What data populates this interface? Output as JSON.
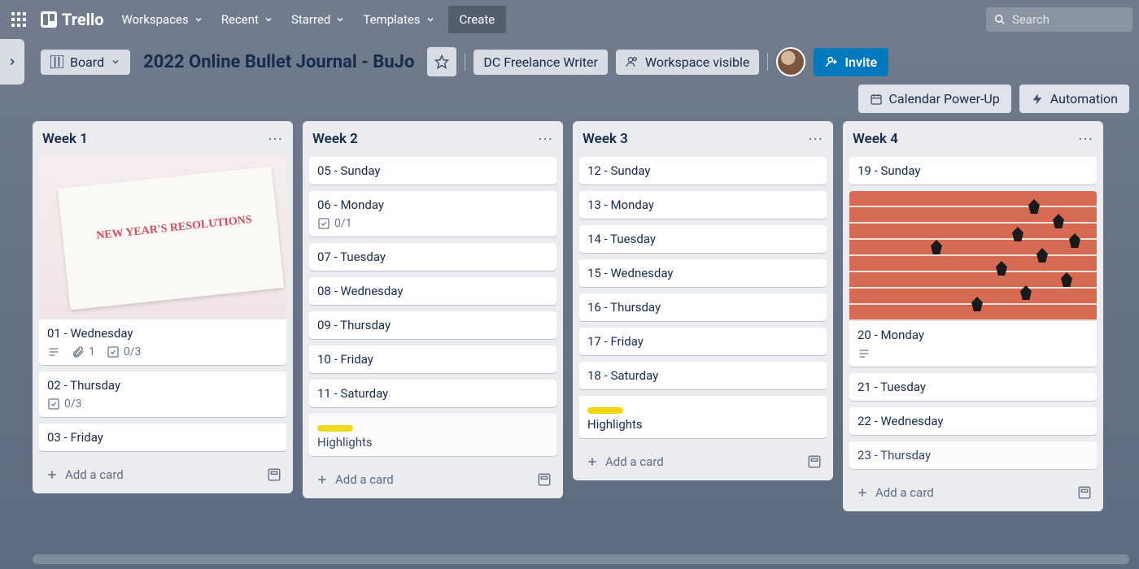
{
  "topnav": {
    "brand": "Trello",
    "items": [
      "Workspaces",
      "Recent",
      "Starred",
      "Templates"
    ],
    "create": "Create",
    "search_placeholder": "Search"
  },
  "board_header": {
    "view_switch": "Board",
    "title": "2022 Online Bullet Journal - BuJo",
    "workspace_button": "DC Freelance Writer",
    "visibility": "Workspace visible",
    "invite": "Invite"
  },
  "secondary": {
    "calendar": "Calendar Power-Up",
    "automation": "Automation"
  },
  "lists": [
    {
      "title": "Week 1",
      "add": "Add a card",
      "cards": [
        {
          "title": "01 - Wednesday",
          "cover": "notebook",
          "badges": {
            "description": true,
            "attachments": "1",
            "checklist": "0/3"
          }
        },
        {
          "title": "02 - Thursday",
          "badges": {
            "checklist": "0/3"
          }
        },
        {
          "title": "03 - Friday"
        }
      ]
    },
    {
      "title": "Week 2",
      "add": "Add a card",
      "cards": [
        {
          "title": "05 - Sunday"
        },
        {
          "title": "06 - Monday",
          "badges": {
            "checklist": "0/1"
          }
        },
        {
          "title": "07 - Tuesday"
        },
        {
          "title": "08 - Wednesday"
        },
        {
          "title": "09 - Thursday"
        },
        {
          "title": "10 - Friday"
        },
        {
          "title": "11 - Saturday"
        },
        {
          "title": "Highlights",
          "label": "yellow",
          "partial": true
        }
      ]
    },
    {
      "title": "Week 3",
      "add": "Add a card",
      "cards": [
        {
          "title": "12 - Sunday"
        },
        {
          "title": "13 - Monday"
        },
        {
          "title": "14 - Tuesday"
        },
        {
          "title": "15 - Wednesday"
        },
        {
          "title": "16 - Thursday"
        },
        {
          "title": "17 - Friday"
        },
        {
          "title": "18 - Saturday"
        },
        {
          "title": "Highlights",
          "label": "yellow"
        }
      ]
    },
    {
      "title": "Week 4",
      "add": "Add a card",
      "cards": [
        {
          "title": "19 - Sunday"
        },
        {
          "title": "20 - Monday",
          "cover": "track",
          "badges": {
            "description": true
          }
        },
        {
          "title": "21 - Tuesday"
        },
        {
          "title": "22 - Wednesday"
        },
        {
          "title": "23 - Thursday",
          "partial": true
        }
      ]
    }
  ]
}
